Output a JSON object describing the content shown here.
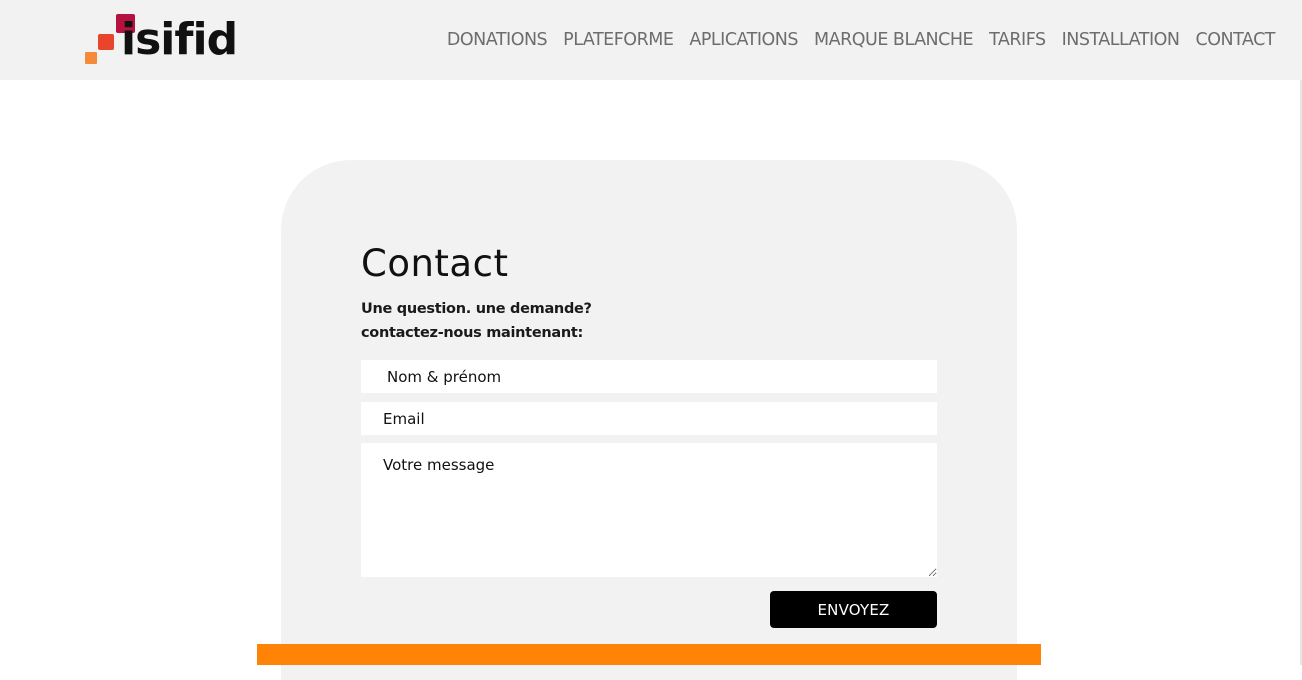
{
  "brand": {
    "logo_text": "isifid",
    "colors": {
      "dark_red": "#b5123f",
      "red_orange": "#e8452c",
      "orange": "#f58a3a"
    }
  },
  "nav": {
    "items": [
      {
        "label": "DONATIONS"
      },
      {
        "label": "PLATEFORME"
      },
      {
        "label": "APLICATIONS"
      },
      {
        "label": "MARQUE BLANCHE"
      },
      {
        "label": "TARIFS"
      },
      {
        "label": "INSTALLATION"
      },
      {
        "label": "CONTACT"
      }
    ]
  },
  "contact": {
    "title": "Contact",
    "subtitle_line1": "Une question. une demande?",
    "subtitle_line2": "contactez-nous maintenant:",
    "name_placeholder": "Nom & prénom",
    "email_placeholder": "Email",
    "message_placeholder": "Votre message",
    "submit_label": "ENVOYEZ"
  },
  "theme": {
    "header_bg": "#f2f2f2",
    "card_bg": "#f2f2f2",
    "accent_orange": "#ff8306",
    "nav_text": "#6d6d6d"
  }
}
